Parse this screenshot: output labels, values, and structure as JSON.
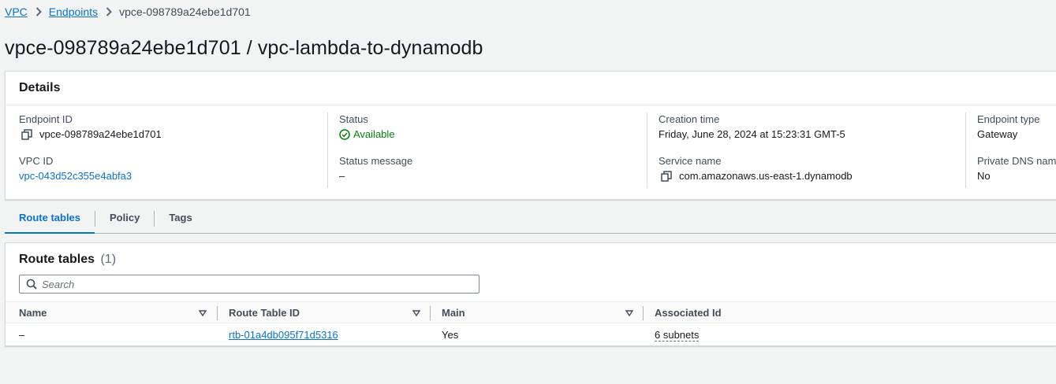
{
  "breadcrumb": {
    "items": [
      {
        "label": "VPC"
      },
      {
        "label": "Endpoints"
      },
      {
        "label": "vpce-098789a24ebe1d701"
      }
    ]
  },
  "page": {
    "title": "vpce-098789a24ebe1d701 / vpc-lambda-to-dynamodb"
  },
  "details": {
    "heading": "Details",
    "endpoint_id_label": "Endpoint ID",
    "endpoint_id_value": "vpce-098789a24ebe1d701",
    "vpc_id_label": "VPC ID",
    "vpc_id_value": "vpc-043d52c355e4abfa3",
    "status_label": "Status",
    "status_value": "Available",
    "status_message_label": "Status message",
    "status_message_value": "–",
    "creation_time_label": "Creation time",
    "creation_time_value": "Friday, June 28, 2024 at 15:23:31 GMT-5",
    "service_name_label": "Service name",
    "service_name_value": "com.amazonaws.us-east-1.dynamodb",
    "endpoint_type_label": "Endpoint type",
    "endpoint_type_value": "Gateway",
    "private_dns_label": "Private DNS name",
    "private_dns_value": "No"
  },
  "tabs": [
    {
      "label": "Route tables",
      "active": true
    },
    {
      "label": "Policy",
      "active": false
    },
    {
      "label": "Tags",
      "active": false
    }
  ],
  "route_tables": {
    "title": "Route tables",
    "count": "(1)",
    "search_placeholder": "Search",
    "columns": [
      "Name",
      "Route Table ID",
      "Main",
      "Associated Id"
    ],
    "rows": [
      {
        "name": "–",
        "route_table_id": "rtb-01a4db095f71d5316",
        "main": "Yes",
        "associated_id": "6 subnets"
      }
    ]
  },
  "colors": {
    "link": "#0972d3",
    "status_ok": "#037f0c",
    "background": "#f2f3f3"
  },
  "icons": {
    "copy": "copy-icon",
    "status": "status-positive-icon",
    "search": "search-icon",
    "sort": "sort-caret-icon",
    "breadcrumb_sep": "chevron-right-icon"
  }
}
